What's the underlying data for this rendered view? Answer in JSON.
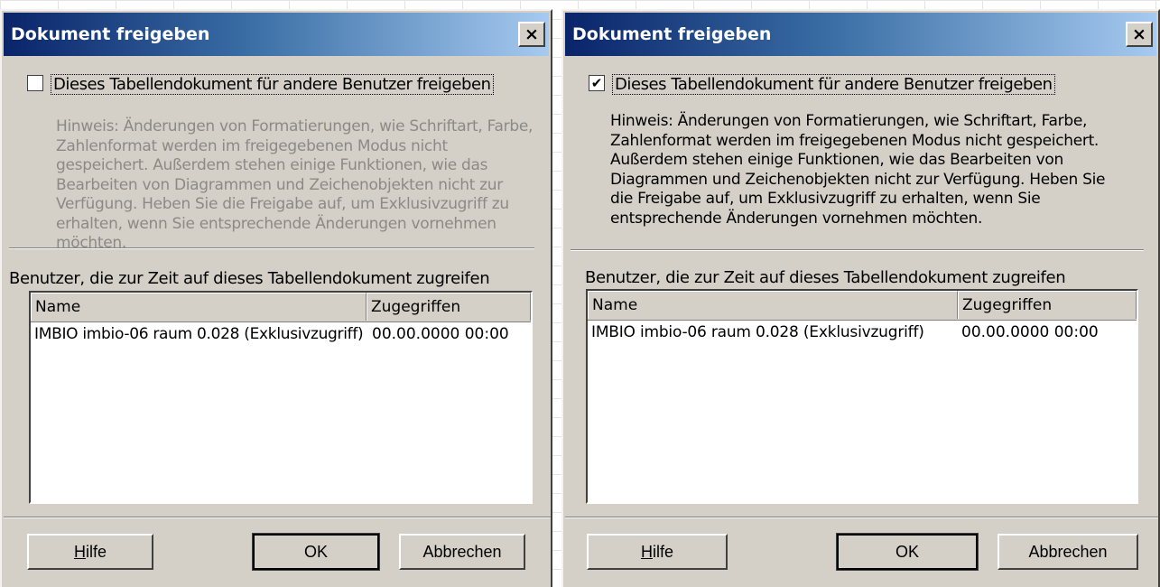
{
  "dialogs": [
    {
      "title": "Dokument freigeben",
      "close_glyph": "×",
      "share_checkbox": {
        "checked": false,
        "glyph": "",
        "label": "Dieses Tabellendokument für andere Benutzer freigeben"
      },
      "hint": "Hinweis: Änderungen von Formatierungen, wie Schriftart, Farbe, Zahlenformat werden im freigegebenen Modus nicht gespeichert. Außerdem stehen einige Funktionen, wie das Bearbeiten von Diagrammen und Zeichenobjekten nicht zur Verfügung. Heben Sie die Freigabe auf, um Exklusivzugriff zu erhalten, wenn Sie entsprechende Änderungen vornehmen möchten.",
      "users_label": "Benutzer, die zur Zeit auf dieses Tabellendokument zugreifen",
      "columns": [
        "Name",
        "Zugegriffen"
      ],
      "rows": [
        {
          "name": "IMBIO imbio-06 raum 0.028 (Exklusivzugriff)",
          "accessed": "00.00.0000 00:00"
        }
      ],
      "buttons": {
        "help_mnemonic": "H",
        "help_rest": "ilfe",
        "ok": "OK",
        "cancel": "Abbrechen"
      }
    },
    {
      "title": "Dokument freigeben",
      "close_glyph": "×",
      "share_checkbox": {
        "checked": true,
        "glyph": "✔",
        "label": "Dieses Tabellendokument für andere Benutzer freigeben"
      },
      "hint": "Hinweis: Änderungen von Formatierungen, wie Schriftart, Farbe, Zahlenformat werden im freigegebenen Modus nicht gespeichert. Außerdem stehen einige Funktionen, wie das Bearbeiten von Diagrammen und Zeichenobjekten nicht zur Verfügung. Heben Sie die Freigabe auf, um Exklusivzugriff zu erhalten, wenn Sie entsprechende Änderungen vornehmen möchten.",
      "users_label": "Benutzer, die zur Zeit auf dieses Tabellendokument zugreifen",
      "columns": [
        "Name",
        "Zugegriffen"
      ],
      "rows": [
        {
          "name": "IMBIO imbio-06 raum 0.028 (Exklusivzugriff)",
          "accessed": "00.00.0000 00:00"
        }
      ],
      "buttons": {
        "help_mnemonic": "H",
        "help_rest": "ilfe",
        "ok": "OK",
        "cancel": "Abbrechen"
      }
    }
  ],
  "colors": {
    "title_gradient_start": "#0a246a",
    "title_gradient_end": "#a6caf0",
    "dialog_face": "#d4d0c8",
    "disabled_text": "#8c8a85"
  }
}
